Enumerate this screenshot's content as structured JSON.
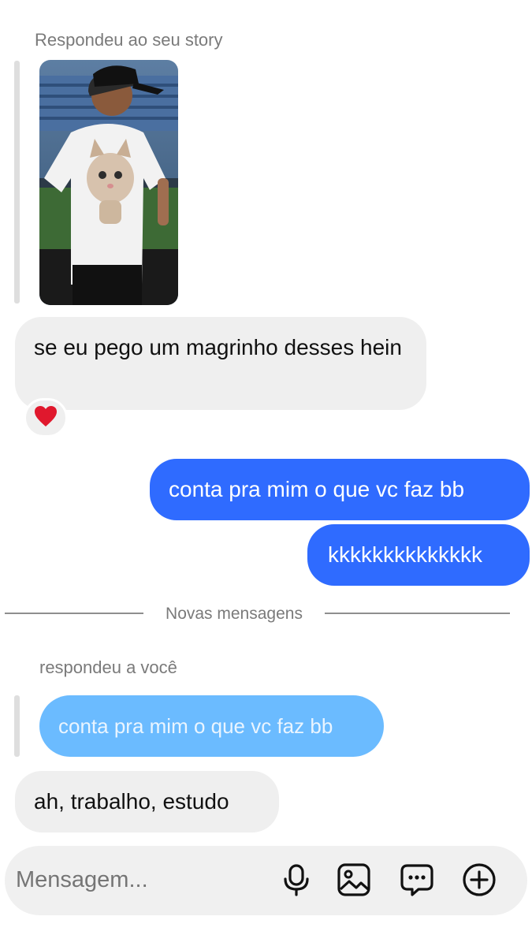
{
  "story_reply": {
    "label": "Respondeu ao seu story",
    "thumbnail": "story-image-person-in-cat-tshirt"
  },
  "messages": [
    {
      "side": "in",
      "text": "se eu pego um magrinho desses hein",
      "reaction": "❤️"
    },
    {
      "side": "out",
      "text": "conta pra mim o que vc faz bb"
    },
    {
      "side": "out",
      "text": "kkkkkkkkkkkkkk"
    }
  ],
  "divider": {
    "label": "Novas mensagens"
  },
  "reply": {
    "label": "respondeu a você",
    "quoted_text": "conta pra mim o que vc faz bb",
    "text": "ah, trabalho, estudo"
  },
  "composer": {
    "placeholder": "Mensagem...",
    "icons": [
      "microphone-icon",
      "gallery-icon",
      "chat-more-icon",
      "add-circle-icon"
    ]
  },
  "colors": {
    "outgoing": "#2f6bff",
    "incoming": "#efefef",
    "quoted": "#6bbbff",
    "reaction_heart": "#e0182d"
  }
}
